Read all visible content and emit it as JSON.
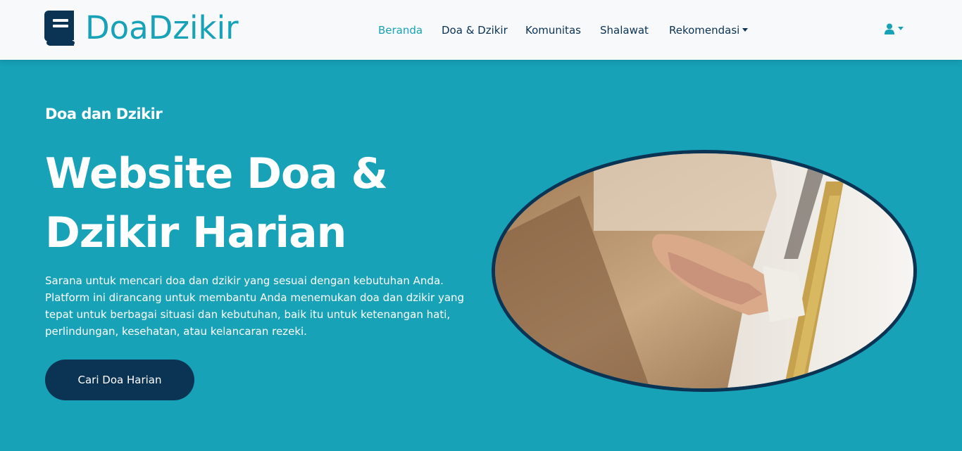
{
  "brand": {
    "name": "DoaDzikir",
    "icon": "book-icon"
  },
  "nav": {
    "items": [
      {
        "label": "Beranda",
        "active": true
      },
      {
        "label": "Doa & Dzikir"
      },
      {
        "label": "Komunitas"
      },
      {
        "label": "Shalawat"
      },
      {
        "label": "Rekomendasi",
        "dropdown": true
      }
    ],
    "user_icon": "user-icon"
  },
  "hero": {
    "subtitle": "Doa dan Dzikir",
    "title": "Website Doa & Dzikir Harian",
    "description": "Sarana untuk mencari doa dan dzikir yang sesuai dengan kebutuhan Anda. Platform ini dirancang untuk membantu Anda menemukan doa dan dzikir yang tepat untuk berbagai situasi dan kebutuhan, baik itu untuk ketenangan hati, perlindungan, kesehatan, atau kelancaran rezeki.",
    "cta_label": "Cari Doa Harian",
    "image": "praying-hands-photo"
  },
  "colors": {
    "primary": "#17a2b8",
    "dark": "#0b3354",
    "navbar_bg": "#f8f9fa"
  }
}
